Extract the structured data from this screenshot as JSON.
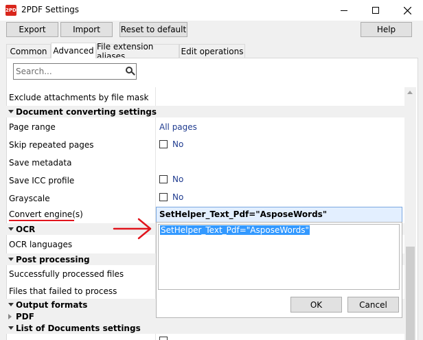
{
  "window": {
    "title": "2PDF Settings",
    "icon_text": "2PDF"
  },
  "toolbar": {
    "export_label": "Export",
    "import_label": "Import",
    "reset_label": "Reset to default",
    "help_label": "Help"
  },
  "tabs": [
    {
      "label": "Common"
    },
    {
      "label": "Advanced"
    },
    {
      "label": "File extension aliases"
    },
    {
      "label": "Edit operations"
    }
  ],
  "search": {
    "placeholder": "Search..."
  },
  "grid": {
    "exclude_label": "Exclude attachments by file mask",
    "cat_doc_converting": "Document converting settings",
    "page_range_label": "Page range",
    "page_range_value": "All pages",
    "skip_repeated_label": "Skip repeated pages",
    "skip_repeated_value": "No",
    "save_metadata_label": "Save metadata",
    "save_icc_label": "Save ICC profile",
    "save_icc_value": "No",
    "grayscale_label": "Grayscale",
    "grayscale_value": "No",
    "convert_engine_label": "Convert engine(s)",
    "cat_ocr": "OCR",
    "ocr_languages_label": "OCR languages",
    "cat_post_processing": "Post processing",
    "successfully_processed_label": "Successfully processed files",
    "failed_label": "Files that failed to process",
    "cat_output_formats": "Output formats",
    "cat_pdf": "PDF",
    "cat_list_docs": "List of Documents settings"
  },
  "dropdown": {
    "value": "SetHelper_Text_Pdf=\"AsposeWords\"",
    "edit_text": "SetHelper_Text_Pdf=\"AsposeWords\"",
    "ok_label": "OK",
    "cancel_label": "Cancel"
  },
  "colors": {
    "annotation": "#e1141c",
    "selection": "#3399ff",
    "link_value": "#1f3b8f"
  }
}
